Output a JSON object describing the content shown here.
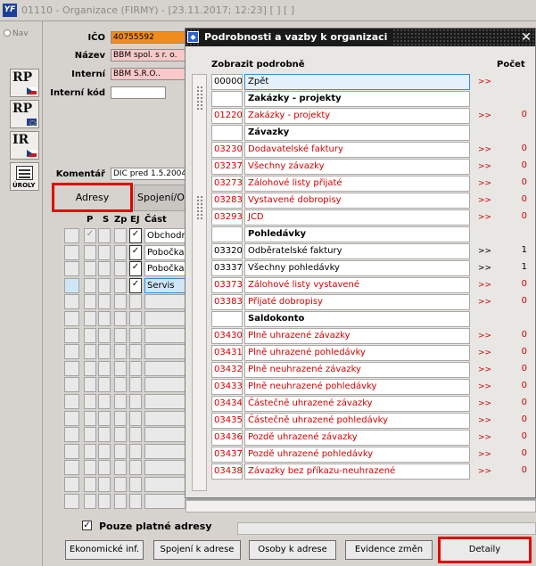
{
  "window": {
    "title": "01110 - Organizace (FIRMY) - [23.11.2017; 12:23]  [ ]  [ ]",
    "app_icon": "YF"
  },
  "sidebar": {
    "nav_label": "Nav",
    "buttons": [
      {
        "label": "RP",
        "flag": "cz"
      },
      {
        "label": "RP",
        "flag": "eu"
      },
      {
        "label": "IR",
        "flag": "cz"
      }
    ],
    "role_label": "ÚROLY"
  },
  "form": {
    "ico_label": "IČO",
    "ico_value": "40755592",
    "nazev_label": "Název",
    "nazev_value": "BBM spol. s r. o.",
    "interni_label": "Interní",
    "interni_value": "BBM S.R.O..",
    "interni_kod_label": "Interní kód",
    "interni_kod_value": "",
    "komentar_label": "Komentář",
    "komentar_value": "DIC pred 1.5.2004"
  },
  "tabs": [
    {
      "label": "Adresy"
    },
    {
      "label": "Spojení/O"
    }
  ],
  "address_grid": {
    "headers": {
      "p": "P",
      "s": "S",
      "zp": "Zp",
      "ej": "EJ",
      "cast": "Část"
    },
    "rows": [
      {
        "cast": "Obchodn"
      },
      {
        "cast": "Pobočka"
      },
      {
        "cast": "Pobočka"
      },
      {
        "cast": "Servis"
      }
    ]
  },
  "only_valid_label": "Pouze platné adresy",
  "bottom_buttons": {
    "economic": "Ekonomické inf.",
    "connection": "Spojení k adrese",
    "persons": "Osoby k adrese",
    "changes": "Evidence změn",
    "details": "Detaily"
  },
  "dialog": {
    "title": "Podrobnosti a vazby k organizaci",
    "col_detail": "Zobrazit podrobně",
    "col_count": "Počet",
    "rows": [
      {
        "code": "00000",
        "name": "Zpět",
        "arrow": ">>",
        "count": "",
        "kind": "sel"
      },
      {
        "code": "",
        "name": "Zakázky - projekty",
        "arrow": "",
        "count": "",
        "kind": "hdr"
      },
      {
        "code": "01220",
        "name": "Zakázky - projekty",
        "arrow": ">>",
        "count": "0",
        "kind": "red"
      },
      {
        "code": "",
        "name": "Závazky",
        "arrow": "",
        "count": "",
        "kind": "hdr"
      },
      {
        "code": "03230",
        "name": "Dodavatelské faktury",
        "arrow": ">>",
        "count": "0",
        "kind": "red"
      },
      {
        "code": "03237",
        "name": "Všechny závazky",
        "arrow": ">>",
        "count": "0",
        "kind": "red"
      },
      {
        "code": "03273",
        "name": "Zálohové listy přijaté",
        "arrow": ">>",
        "count": "0",
        "kind": "red"
      },
      {
        "code": "03283",
        "name": "Vystavené dobropisy",
        "arrow": ">>",
        "count": "0",
        "kind": "red"
      },
      {
        "code": "03293",
        "name": "JCD",
        "arrow": ">>",
        "count": "0",
        "kind": "red"
      },
      {
        "code": "",
        "name": "Pohledávky",
        "arrow": "",
        "count": "",
        "kind": "hdr"
      },
      {
        "code": "03320",
        "name": "Odběratelské faktury",
        "arrow": ">>",
        "count": "1",
        "kind": "blk"
      },
      {
        "code": "03337",
        "name": "Všechny pohledávky",
        "arrow": ">>",
        "count": "1",
        "kind": "blk"
      },
      {
        "code": "03373",
        "name": "Zálohové listy vystavené",
        "arrow": ">>",
        "count": "0",
        "kind": "red"
      },
      {
        "code": "03383",
        "name": "Přijaté dobropisy",
        "arrow": ">>",
        "count": "0",
        "kind": "red"
      },
      {
        "code": "",
        "name": "Saldokonto",
        "arrow": "",
        "count": "",
        "kind": "hdr"
      },
      {
        "code": "03430",
        "name": "Plně uhrazené závazky",
        "arrow": ">>",
        "count": "0",
        "kind": "red"
      },
      {
        "code": "03431",
        "name": "Plně uhrazené pohledávky",
        "arrow": ">>",
        "count": "0",
        "kind": "red"
      },
      {
        "code": "03432",
        "name": "Plně neuhrazené závazky",
        "arrow": ">>",
        "count": "0",
        "kind": "red"
      },
      {
        "code": "03433",
        "name": "Plně neuhrazené pohledávky",
        "arrow": ">>",
        "count": "0",
        "kind": "red"
      },
      {
        "code": "03434",
        "name": "Částečně uhrazené závazky",
        "arrow": ">>",
        "count": "0",
        "kind": "red"
      },
      {
        "code": "03435",
        "name": "Částečně uhrazené pohledávky",
        "arrow": ">>",
        "count": "0",
        "kind": "red"
      },
      {
        "code": "03436",
        "name": "Pozdě uhrazené závazky",
        "arrow": ">>",
        "count": "0",
        "kind": "red"
      },
      {
        "code": "03437",
        "name": "Pozdě uhrazené pohledávky",
        "arrow": ">>",
        "count": "0",
        "kind": "red"
      },
      {
        "code": "03438",
        "name": "Závazky bez příkazu-neuhrazené",
        "arrow": ">>",
        "count": "0",
        "kind": "red"
      }
    ]
  },
  "colors": {
    "accent_red": "#e50000",
    "ico_orange": "#f08c1e",
    "pink_field": "#f9c9c9",
    "selected_blue": "#3d8ad6"
  }
}
